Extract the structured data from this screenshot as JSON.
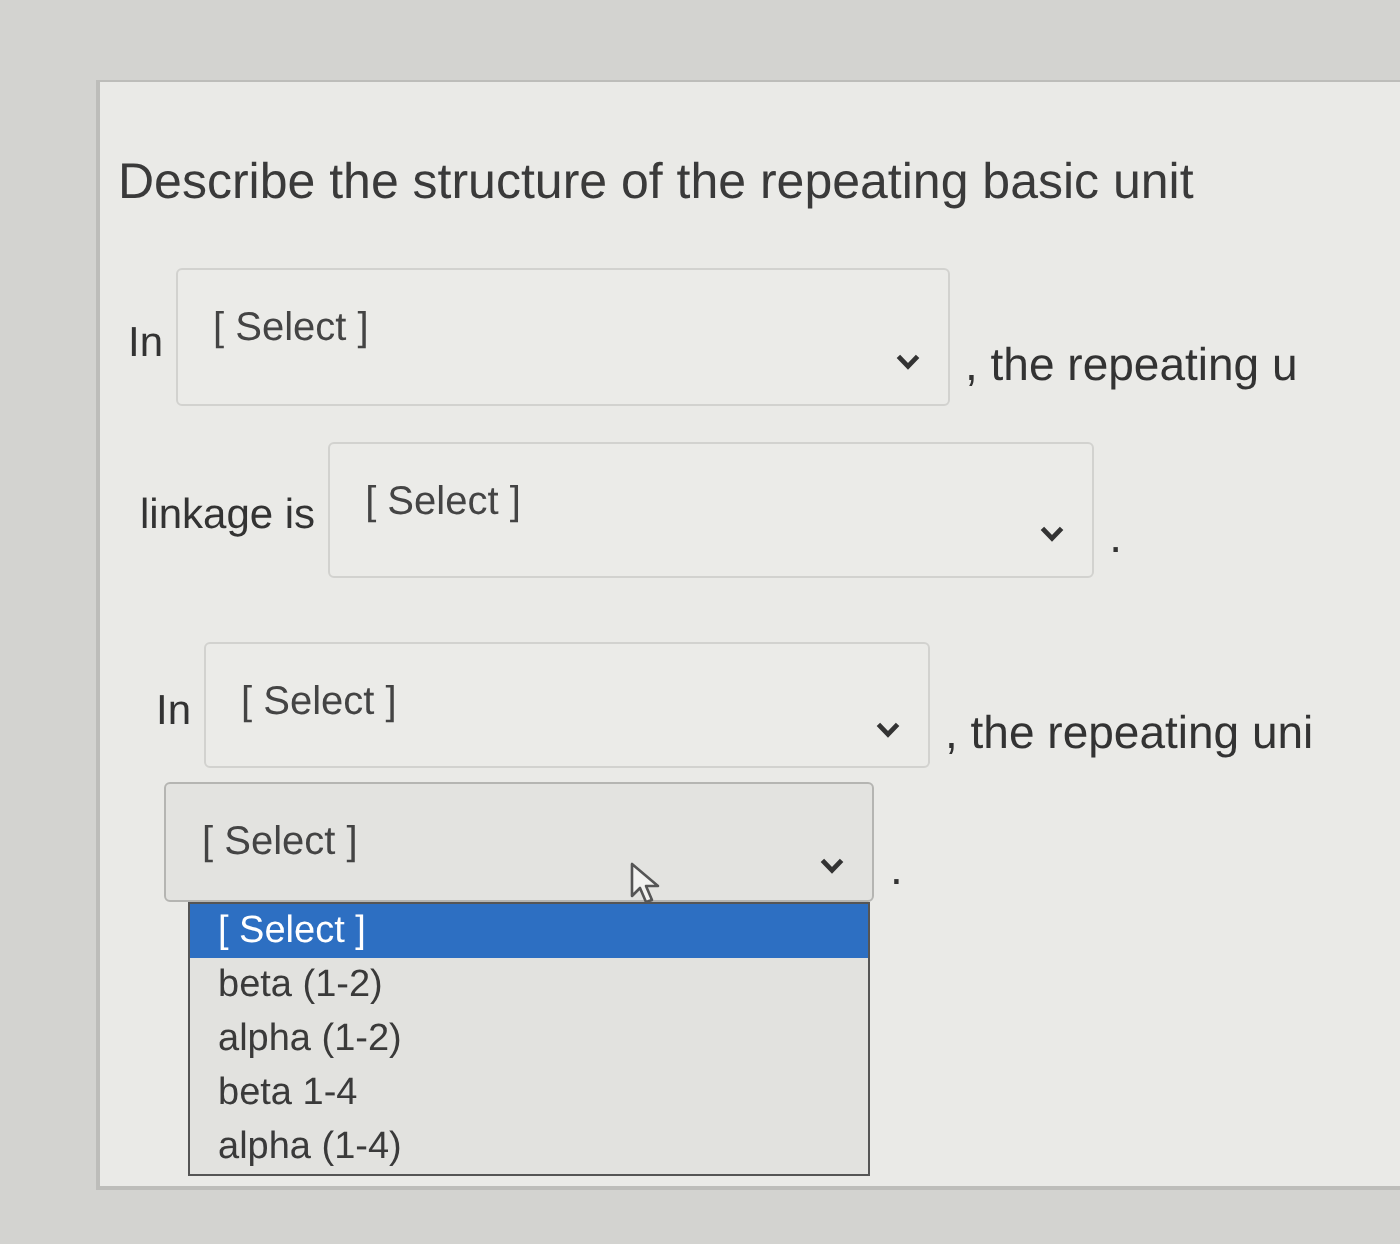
{
  "question": "Describe the structure of the repeating basic unit",
  "lines": [
    {
      "parts": [
        {
          "kind": "text",
          "text": "In"
        },
        {
          "kind": "select",
          "value": "[ Select ]",
          "expanded": false
        },
        {
          "kind": "text",
          "text": ", the repeating u"
        }
      ]
    },
    {
      "parts": [
        {
          "kind": "text",
          "text": "linkage is"
        },
        {
          "kind": "select",
          "value": "[ Select ]",
          "expanded": false
        },
        {
          "kind": "text",
          "text": "."
        }
      ]
    },
    {
      "parts": [
        {
          "kind": "text",
          "text": "In"
        },
        {
          "kind": "select",
          "value": "[ Select ]",
          "expanded": false
        },
        {
          "kind": "text",
          "text": ", the repeating uni"
        }
      ]
    },
    {
      "parts": [
        {
          "kind": "select",
          "value": "[ Select ]",
          "expanded": true,
          "options": [
            {
              "label": "[ Select ]",
              "selected": true
            },
            {
              "label": "beta (1-2)",
              "selected": false
            },
            {
              "label": "alpha (1-2)",
              "selected": false
            },
            {
              "label": "beta 1-4",
              "selected": false
            },
            {
              "label": "alpha (1-4)",
              "selected": false
            }
          ]
        },
        {
          "kind": "text",
          "text": "."
        }
      ]
    }
  ]
}
